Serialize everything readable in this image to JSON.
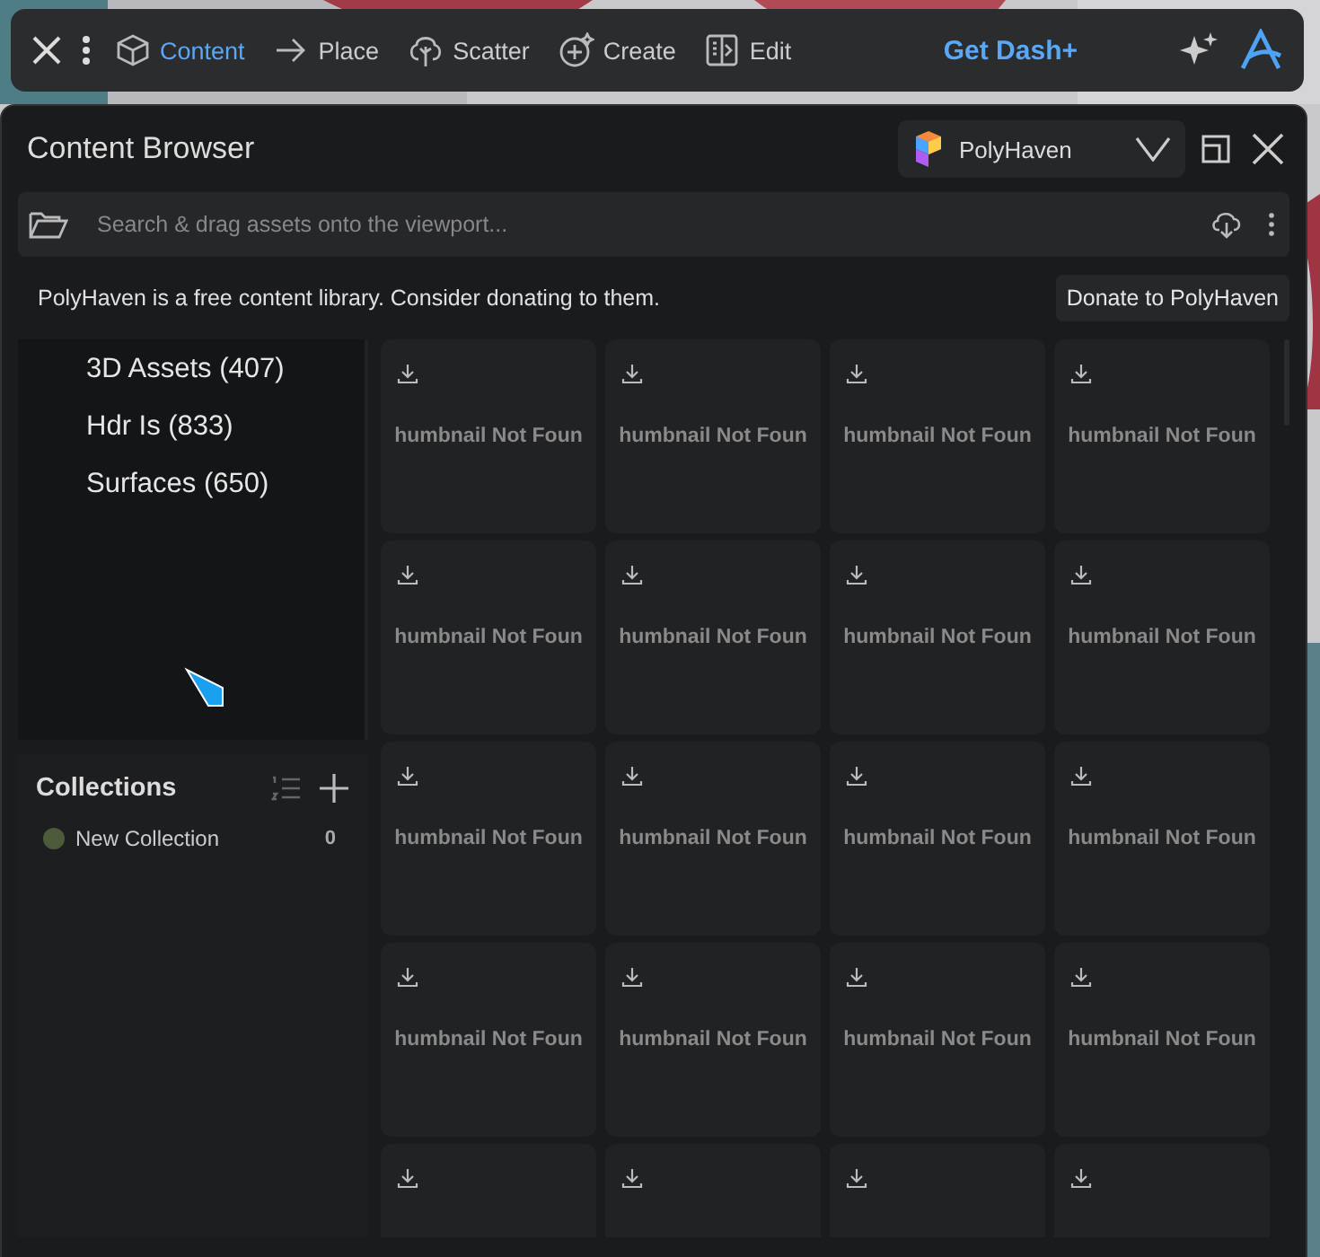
{
  "toolbar": {
    "tabs": [
      {
        "label": "Content",
        "kind": "box",
        "selected": true
      },
      {
        "label": "Place",
        "kind": "arrow",
        "selected": false
      },
      {
        "label": "Scatter",
        "kind": "tree",
        "selected": false
      },
      {
        "label": "Create",
        "kind": "plus",
        "selected": false
      },
      {
        "label": "Edit",
        "kind": "edit",
        "selected": false
      }
    ],
    "promo": "Get Dash+"
  },
  "panel": {
    "title": "Content Browser",
    "source": "PolyHaven"
  },
  "search": {
    "placeholder": "Search & drag assets onto the viewport..."
  },
  "info": {
    "text": "PolyHaven is a free content library. Consider donating to them.",
    "button": "Donate to PolyHaven"
  },
  "categories": [
    {
      "label": "3D Assets (407)"
    },
    {
      "label": "Hdr Is (833)"
    },
    {
      "label": "Surfaces (650)"
    }
  ],
  "collections": {
    "title": "Collections",
    "items": [
      {
        "name": "New Collection",
        "count": "0",
        "color": "#4e5b3a"
      }
    ]
  },
  "cards": [
    {
      "kind": "full",
      "label": "humbnail Not Foun"
    },
    {
      "kind": "full",
      "label": "humbnail Not Foun"
    },
    {
      "kind": "full",
      "label": "humbnail Not Foun"
    },
    {
      "kind": "full",
      "label": "humbnail Not Foun"
    },
    {
      "kind": "full",
      "label": "humbnail Not Foun"
    },
    {
      "kind": "full",
      "label": "humbnail Not Foun"
    },
    {
      "kind": "full",
      "label": "humbnail Not Foun"
    },
    {
      "kind": "full",
      "label": "humbnail Not Foun"
    },
    {
      "kind": "full",
      "label": "humbnail Not Foun"
    },
    {
      "kind": "full",
      "label": "humbnail Not Foun"
    },
    {
      "kind": "full",
      "label": "humbnail Not Foun"
    },
    {
      "kind": "full",
      "label": "humbnail Not Foun"
    },
    {
      "kind": "full",
      "label": "humbnail Not Foun"
    },
    {
      "kind": "full",
      "label": "humbnail Not Foun"
    },
    {
      "kind": "full",
      "label": "humbnail Not Foun"
    },
    {
      "kind": "full",
      "label": "humbnail Not Foun"
    },
    {
      "kind": "partial"
    },
    {
      "kind": "partial"
    },
    {
      "kind": "partial"
    },
    {
      "kind": "partial"
    }
  ]
}
